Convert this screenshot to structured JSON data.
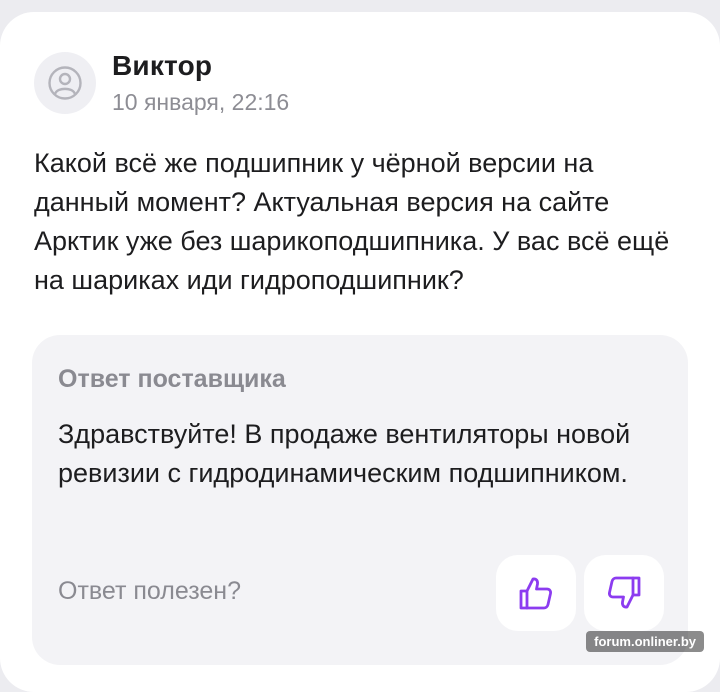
{
  "review": {
    "author": "Виктор",
    "date": "10 января, 22:16",
    "question": "Какой всё же подшипник у чёрной версии на данный момент? Актуальная версия на сайте Арктик уже без шарикоподшипника. У вас всё ещё на шариках иди гидроподшипник?"
  },
  "reply": {
    "title": "Ответ поставщика",
    "text": "Здравствуйте! В продаже вентиляторы новой ревизии с гидродинамическим подшипником.",
    "helpful_prompt": "Ответ полезен?"
  },
  "watermark": "forum.onliner.by",
  "icons": {
    "avatar": "user-avatar-icon",
    "like": "thumbs-up-icon",
    "dislike": "thumbs-down-icon"
  },
  "colors": {
    "accent": "#8c3cf0",
    "muted": "#8a8a91",
    "reply_bg": "#f3f3f6"
  }
}
